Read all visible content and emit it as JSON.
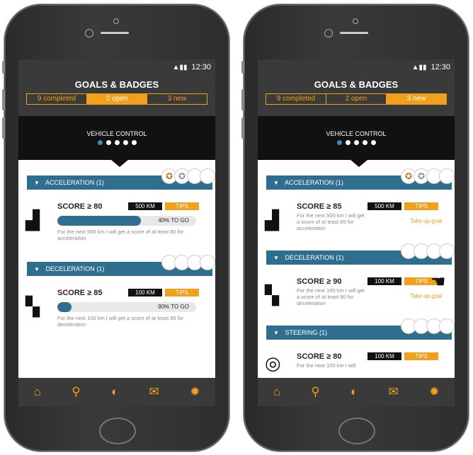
{
  "status": {
    "time": "12:30",
    "signal": "▲▮▮"
  },
  "title": "GOALS & BADGES",
  "tabs": [
    {
      "label": "9 completed"
    },
    {
      "label": "2 open"
    },
    {
      "label": "3 new"
    }
  ],
  "banner_title": "VEHICLE CONTROL",
  "left": {
    "sections": [
      {
        "name": "ACCELERATION",
        "count": "(1)",
        "score": "SCORE ≥ 80",
        "km": "500 KM",
        "tips": "TIPS",
        "progress": 0.6,
        "togo": "40% TO GO",
        "desc": "For the next 500 km I will get a score of at least 80 for acceleration"
      },
      {
        "name": "DECELERATION",
        "count": "(1)",
        "score": "SCORE ≥ 85",
        "km": "100 KM",
        "tips": "TIPS",
        "progress": 0.1,
        "togo": "90% TO GO",
        "desc": "For the next 100 km I will get a score of at least 85 for deceleration"
      }
    ]
  },
  "right": {
    "sections": [
      {
        "name": "ACCELERATION",
        "count": "(1)",
        "score": "SCORE ≥ 85",
        "km": "500 KM",
        "tips": "TIPS",
        "take": "Take up goal",
        "desc": "For the next 500 km I will get a score of at least 85 for acceleration"
      },
      {
        "name": "DECELERATION",
        "count": "(1)",
        "score": "SCORE ≥ 90",
        "km": "100 KM",
        "tips": "TIPS",
        "take": "Take up goal",
        "desc": "For the next 100 km I will get a score of at least 90 for deceleration"
      },
      {
        "name": "STEERING",
        "count": "(1)",
        "score": "SCORE ≥ 80",
        "km": "100 KM",
        "tips": "TIPS",
        "desc": "For the next 100 km I will"
      }
    ]
  },
  "nav": [
    "home-icon",
    "route-icon",
    "compass-icon",
    "mail-icon",
    "settings-icon"
  ],
  "colors": {
    "accent": "#f0a01a",
    "section": "#2f6e8e",
    "dark": "#3a3a3a"
  }
}
